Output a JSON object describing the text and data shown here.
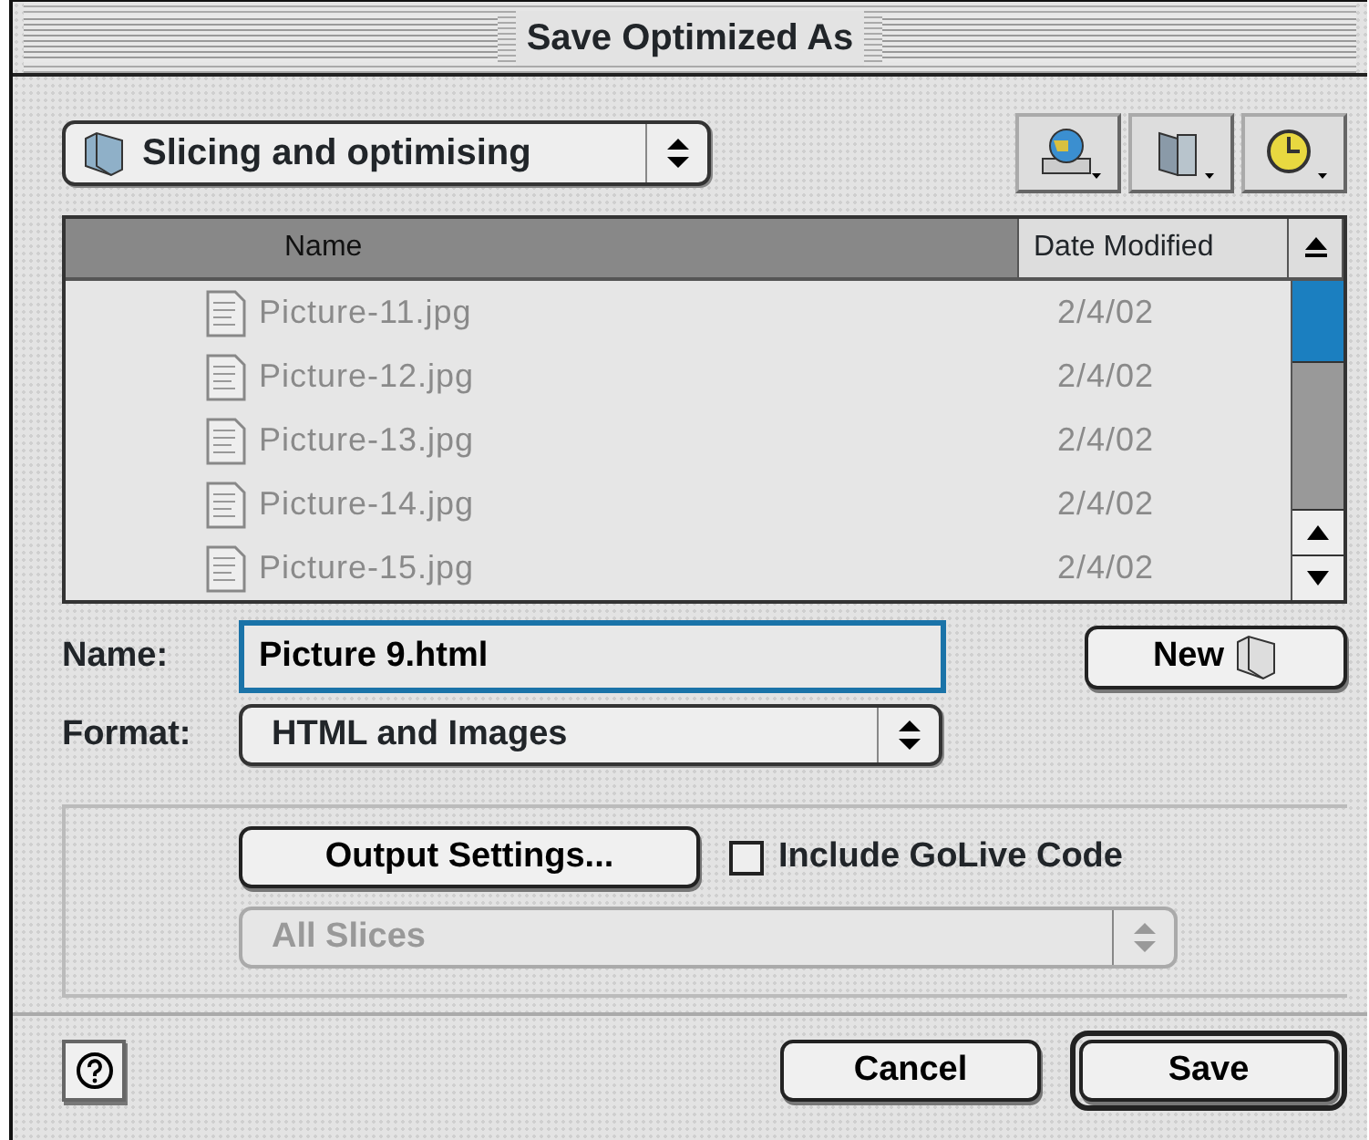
{
  "window": {
    "title": "Save Optimized As"
  },
  "folder_popup": {
    "value": "Slicing and optimising"
  },
  "file_list": {
    "columns": [
      {
        "label": "Name",
        "selected": true
      },
      {
        "label": "Date Modified",
        "selected": false
      }
    ],
    "rows": [
      {
        "name": "Picture-11.jpg",
        "date": "2/4/02",
        "disabled": true
      },
      {
        "name": "Picture-12.jpg",
        "date": "2/4/02",
        "disabled": true
      },
      {
        "name": "Picture-13.jpg",
        "date": "2/4/02",
        "disabled": true
      },
      {
        "name": "Picture-14.jpg",
        "date": "2/4/02",
        "disabled": true
      },
      {
        "name": "Picture-15.jpg",
        "date": "2/4/02",
        "disabled": true
      }
    ]
  },
  "name_field": {
    "label": "Name:",
    "value": "Picture 9.html"
  },
  "new_folder_button": {
    "label": "New"
  },
  "format": {
    "label": "Format:",
    "value": "HTML and Images"
  },
  "output_settings_button": {
    "label": "Output Settings..."
  },
  "include_golive": {
    "label": "Include GoLive Code",
    "checked": false
  },
  "slices_popup": {
    "value": "All Slices",
    "disabled": true
  },
  "buttons": [
    {
      "label": "Cancel",
      "default": false
    },
    {
      "label": "Save",
      "default": true
    }
  ]
}
